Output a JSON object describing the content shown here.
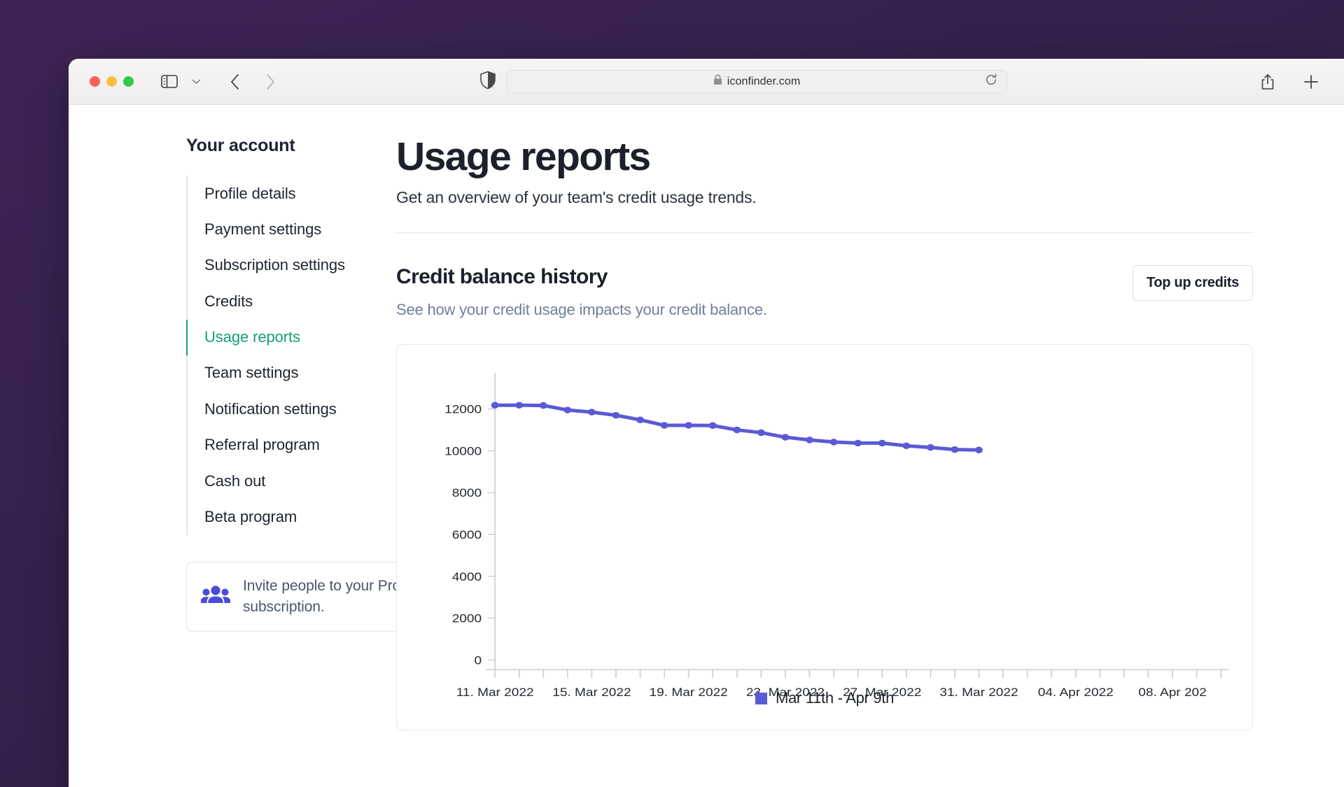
{
  "browser": {
    "url": "iconfinder.com",
    "lock_icon": "lock-icon",
    "shield_icon": "shield-icon",
    "back_icon": "chevron-left-icon",
    "forward_icon": "chevron-right-icon",
    "sidebar_icon": "sidebar-toggle-icon",
    "tab_overview_icon": "chevron-down-icon",
    "reload_icon": "reload-icon",
    "share_icon": "share-icon",
    "newtab_icon": "plus-icon"
  },
  "sidebar": {
    "title": "Your account",
    "items": [
      {
        "label": "Profile details",
        "active": false
      },
      {
        "label": "Payment settings",
        "active": false
      },
      {
        "label": "Subscription settings",
        "active": false
      },
      {
        "label": "Credits",
        "active": false
      },
      {
        "label": "Usage reports",
        "active": true
      },
      {
        "label": "Team settings",
        "active": false
      },
      {
        "label": "Notification settings",
        "active": false
      },
      {
        "label": "Referral program",
        "active": false
      },
      {
        "label": "Cash out",
        "active": false
      },
      {
        "label": "Beta program",
        "active": false
      }
    ],
    "invite": {
      "icon": "people-group-icon",
      "text": "Invite people to your Pro subscription."
    }
  },
  "main": {
    "title": "Usage reports",
    "subtitle": "Get an overview of your team's credit usage trends.",
    "section": {
      "title": "Credit balance history",
      "subtitle": "See how your credit usage impacts your credit balance.",
      "topup_label": "Top up credits"
    }
  },
  "colors": {
    "accent_green": "#14a07a",
    "series_blue": "#5a5ad6",
    "link_blue_gray": "#6d7f99",
    "heading": "#1b202b"
  },
  "chart_data": {
    "type": "line",
    "title": "Credit balance history",
    "xlabel": "",
    "ylabel": "",
    "ylim": [
      0,
      13000
    ],
    "yticks": [
      0,
      2000,
      4000,
      6000,
      8000,
      10000,
      12000
    ],
    "ytick_labels": [
      "0",
      "2000",
      "4000",
      "6000",
      "8000",
      "10000",
      "12000"
    ],
    "xtick_labels": [
      "11. Mar 2022",
      "15. Mar 2022",
      "19. Mar 2022",
      "23. Mar 2022",
      "27. Mar 2022",
      "31. Mar 2022",
      "04. Apr 2022",
      "08. Apr 202"
    ],
    "x_axis_days": 30,
    "grid": false,
    "legend_position": "bottom",
    "series": [
      {
        "name": "Mar 11th - Apr 9th",
        "color": "#5a5ad6",
        "x": [
          "11. Mar 2022",
          "12. Mar 2022",
          "13. Mar 2022",
          "14. Mar 2022",
          "15. Mar 2022",
          "16. Mar 2022",
          "17. Mar 2022",
          "18. Mar 2022",
          "19. Mar 2022",
          "20. Mar 2022",
          "21. Mar 2022",
          "22. Mar 2022",
          "23. Mar 2022",
          "24. Mar 2022",
          "25. Mar 2022",
          "26. Mar 2022",
          "27. Mar 2022",
          "28. Mar 2022",
          "29. Mar 2022",
          "30. Mar 2022",
          "31. Mar 2022"
        ],
        "values": [
          12180,
          12180,
          12170,
          11950,
          11850,
          11700,
          11480,
          11220,
          11220,
          11210,
          11000,
          10870,
          10650,
          10520,
          10420,
          10370,
          10370,
          10240,
          10160,
          10060,
          10040
        ]
      }
    ]
  }
}
